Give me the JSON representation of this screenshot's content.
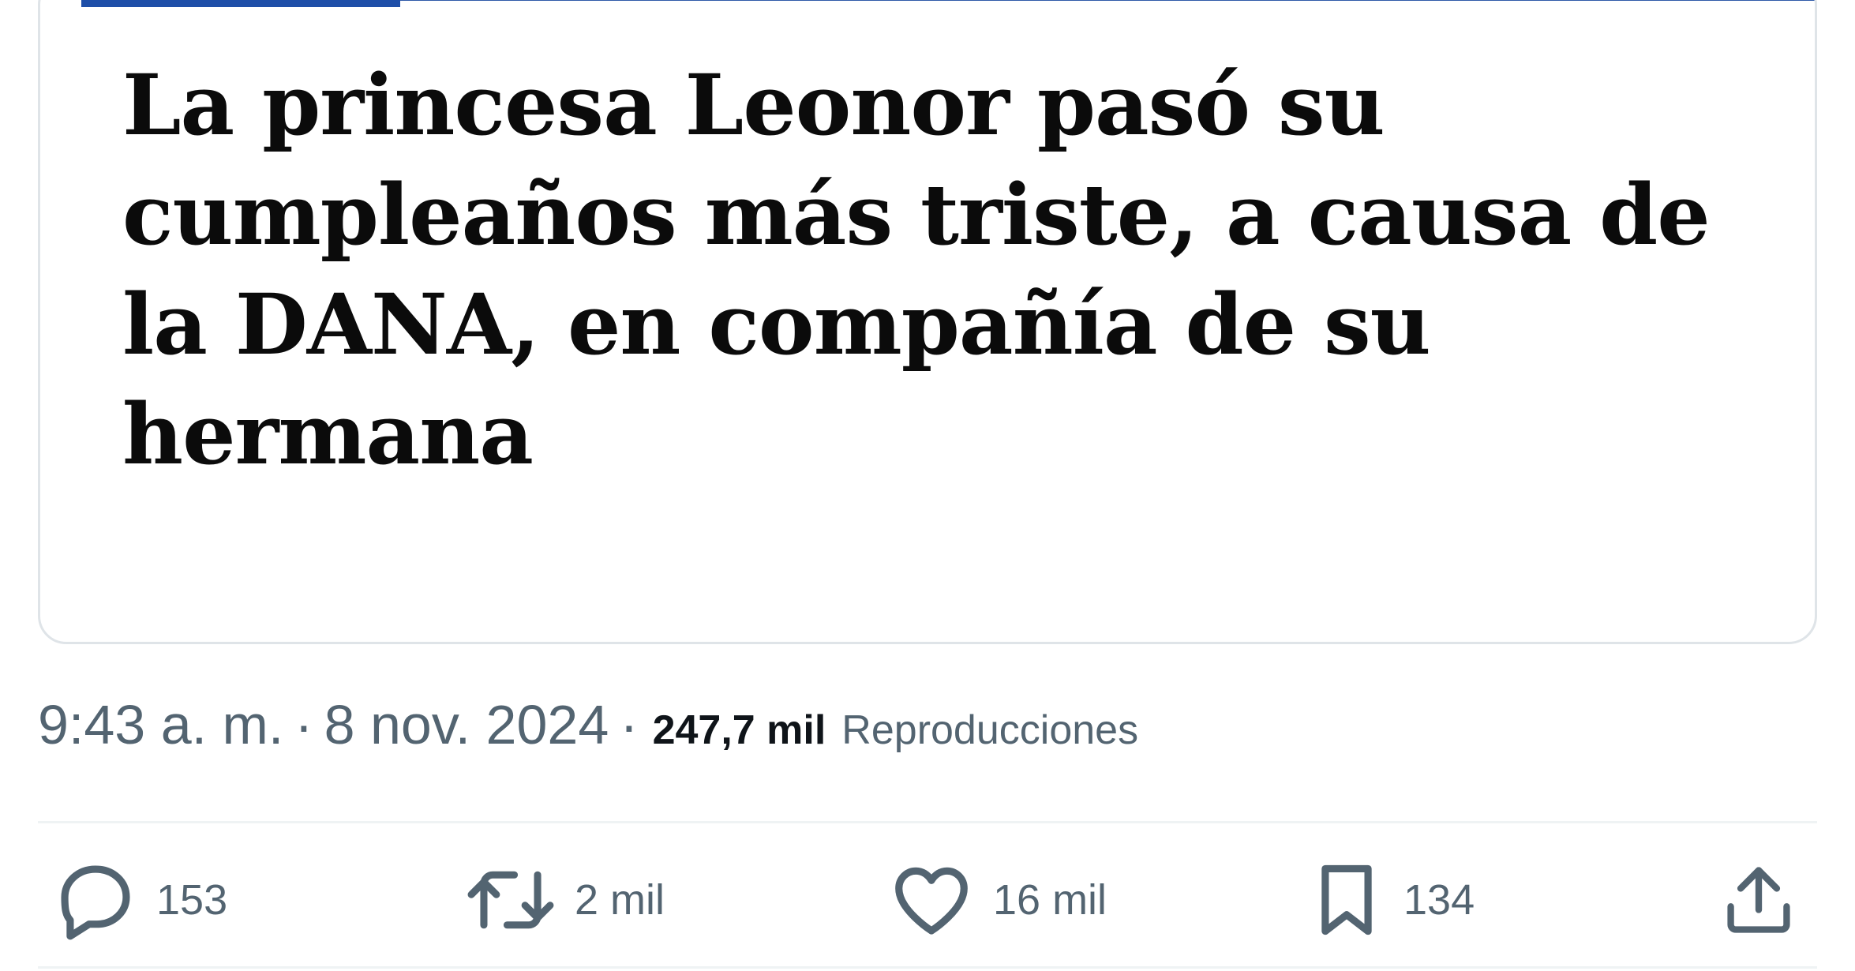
{
  "headline": "La princesa Leonor pasó su cumpleaños más triste, a causa de la DANA, en compañía de su hermana",
  "progress": {
    "fraction": 0.18,
    "color": "#1e4ea8"
  },
  "meta": {
    "time": "9:43 a. m.",
    "separator": "·",
    "date": "8 nov. 2024",
    "views_count": "247,7 mil",
    "views_label": "Reproducciones"
  },
  "actions": {
    "reply": {
      "icon": "reply-icon",
      "count": "153"
    },
    "retweet": {
      "icon": "retweet-icon",
      "count": "2 mil"
    },
    "like": {
      "icon": "heart-icon",
      "count": "16 mil"
    },
    "bookmark": {
      "icon": "bookmark-icon",
      "count": "134"
    },
    "share": {
      "icon": "share-icon"
    }
  },
  "colors": {
    "secondary_text": "#536471",
    "primary_text": "#0f1419",
    "card_border": "#dfe4e8"
  }
}
